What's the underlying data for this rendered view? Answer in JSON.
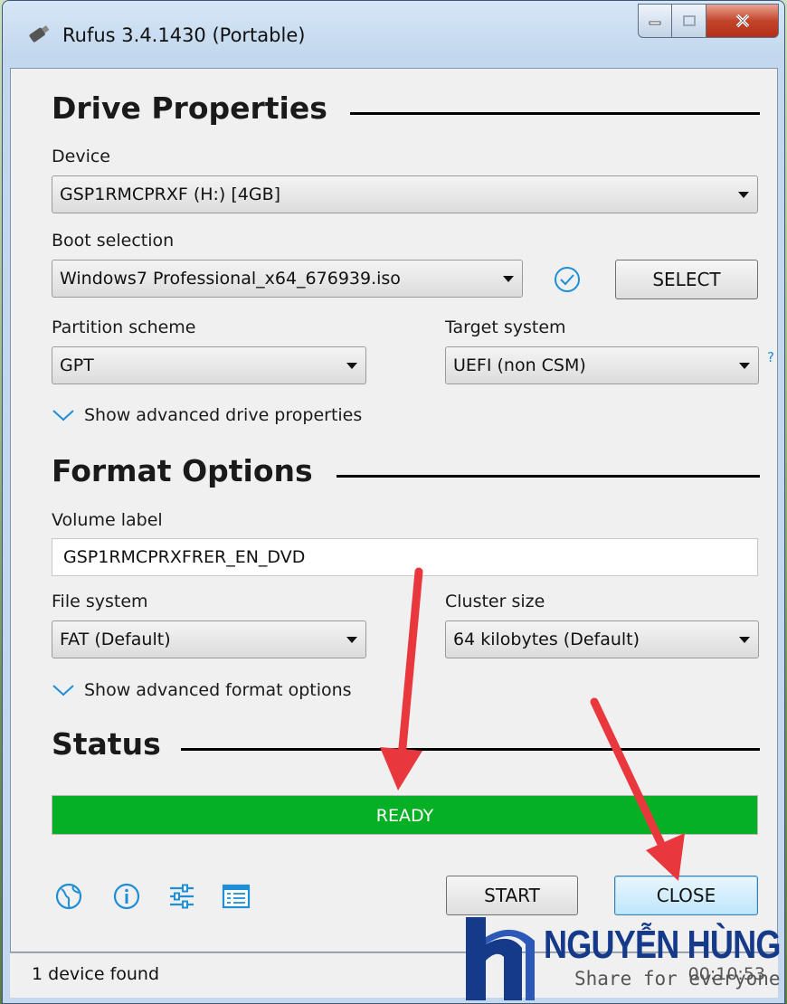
{
  "window": {
    "title": "Rufus 3.4.1430 (Portable)"
  },
  "drive_properties": {
    "heading": "Drive Properties",
    "device": {
      "label": "Device",
      "value": "GSP1RMCPRXF (H:) [4GB]"
    },
    "boot_selection": {
      "label": "Boot selection",
      "value": "Windows7 Professional_x64_676939.iso",
      "select_label": "SELECT"
    },
    "partition_scheme": {
      "label": "Partition scheme",
      "value": "GPT"
    },
    "target_system": {
      "label": "Target system",
      "value": "UEFI (non CSM)",
      "help": "?"
    },
    "advanced_toggle": "Show advanced drive properties"
  },
  "format_options": {
    "heading": "Format Options",
    "volume_label": {
      "label": "Volume label",
      "value": "GSP1RMCPRXFRER_EN_DVD"
    },
    "file_system": {
      "label": "File system",
      "value": "FAT (Default)"
    },
    "cluster_size": {
      "label": "Cluster size",
      "value": "64 kilobytes (Default)"
    },
    "advanced_toggle": "Show advanced format options"
  },
  "status": {
    "heading": "Status",
    "progress_text": "READY",
    "progress_fraction": 1.0,
    "progress_color": "#06b025"
  },
  "footer": {
    "icons": [
      "globe-icon",
      "info-icon",
      "settings-sliders-icon",
      "log-icon"
    ],
    "start_label": "START",
    "close_label": "CLOSE"
  },
  "statusbar": {
    "text": "1 device found",
    "timer": "00:10:53"
  },
  "watermark": {
    "brand": "NGUYỄN HÙNG",
    "tagline": "Share for everyone"
  },
  "colors": {
    "accent": "#1e8fd6",
    "annotation_arrow": "#e8383d"
  }
}
